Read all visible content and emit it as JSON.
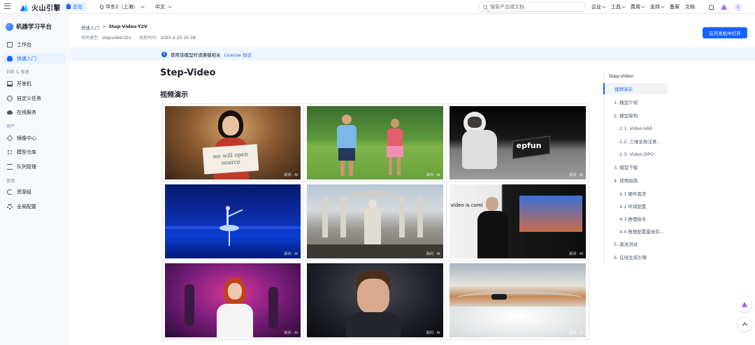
{
  "topbar": {
    "brand": "火山引擎",
    "home": "总览",
    "region": "华东2（上海）",
    "language": "中文",
    "search_placeholder": "搜索产品或文档",
    "nav": [
      "企业",
      "工具",
      "费用",
      "支持",
      "备案",
      "文档"
    ],
    "avatar_letter": "c"
  },
  "sidebar": {
    "platform": "机器学习平台",
    "items": [
      {
        "label": "工作台",
        "icon": "desktop-icon"
      },
      {
        "label": "快速入门",
        "icon": "bulb-icon",
        "active": true
      },
      {
        "group": "训练 & 推理"
      },
      {
        "label": "开发机",
        "icon": "devbox-icon"
      },
      {
        "label": "自定义任务",
        "icon": "task-icon"
      },
      {
        "label": "在线服务",
        "icon": "cloud-icon"
      },
      {
        "group": "资产"
      },
      {
        "label": "镜像中心",
        "icon": "image-icon"
      },
      {
        "label": "模型仓库",
        "icon": "model-icon"
      },
      {
        "label": "队列管理",
        "icon": "queue-icon"
      },
      {
        "group": "管理"
      },
      {
        "label": "资源组",
        "icon": "resource-icon"
      },
      {
        "label": "全局配置",
        "icon": "gear-icon"
      }
    ]
  },
  "header": {
    "breadcrumb": [
      "快速入门",
      "Step-Video-T2V"
    ],
    "model_label": "相关模型：",
    "model_value": "stepvideo-t2v",
    "updated_label": "更新时间：",
    "updated_value": "2025-2-25 20:38",
    "open_button": "在开发机中打开"
  },
  "notice": {
    "text": "使用该模型时请遵循相关",
    "link": "License 协议"
  },
  "content": {
    "title": "Step-Video",
    "section": "视频演示",
    "watermark": "跃问 · AI",
    "sign_line1": "we will open",
    "sign_line2": "source",
    "slide_text": "video is comi",
    "laptop_text": "epfun"
  },
  "toc": {
    "title": "Step-Video",
    "items": [
      {
        "label": "视频演示",
        "level": 1,
        "active": true
      },
      {
        "label": "1. 模型介绍",
        "level": 1
      },
      {
        "label": "2. 模型架构",
        "level": 1
      },
      {
        "label": "2.1. Video-VAE",
        "level": 2
      },
      {
        "label": "2.2. 三维全局注意...",
        "level": 2
      },
      {
        "label": "2.3. Video-DPO",
        "level": 2
      },
      {
        "label": "3. 模型下载",
        "level": 1
      },
      {
        "label": "4. 使用指南",
        "level": 1
      },
      {
        "label": "4.1 硬件需求",
        "level": 2
      },
      {
        "label": "4.2 环境配置",
        "level": 2
      },
      {
        "label": "4.3 推理指令",
        "level": 2
      },
      {
        "label": "4.4 推理配置最佳实...",
        "level": 2
      },
      {
        "label": "5. 基准测试",
        "level": 1
      },
      {
        "label": "6. 在线生成引擎",
        "level": 1
      }
    ]
  }
}
